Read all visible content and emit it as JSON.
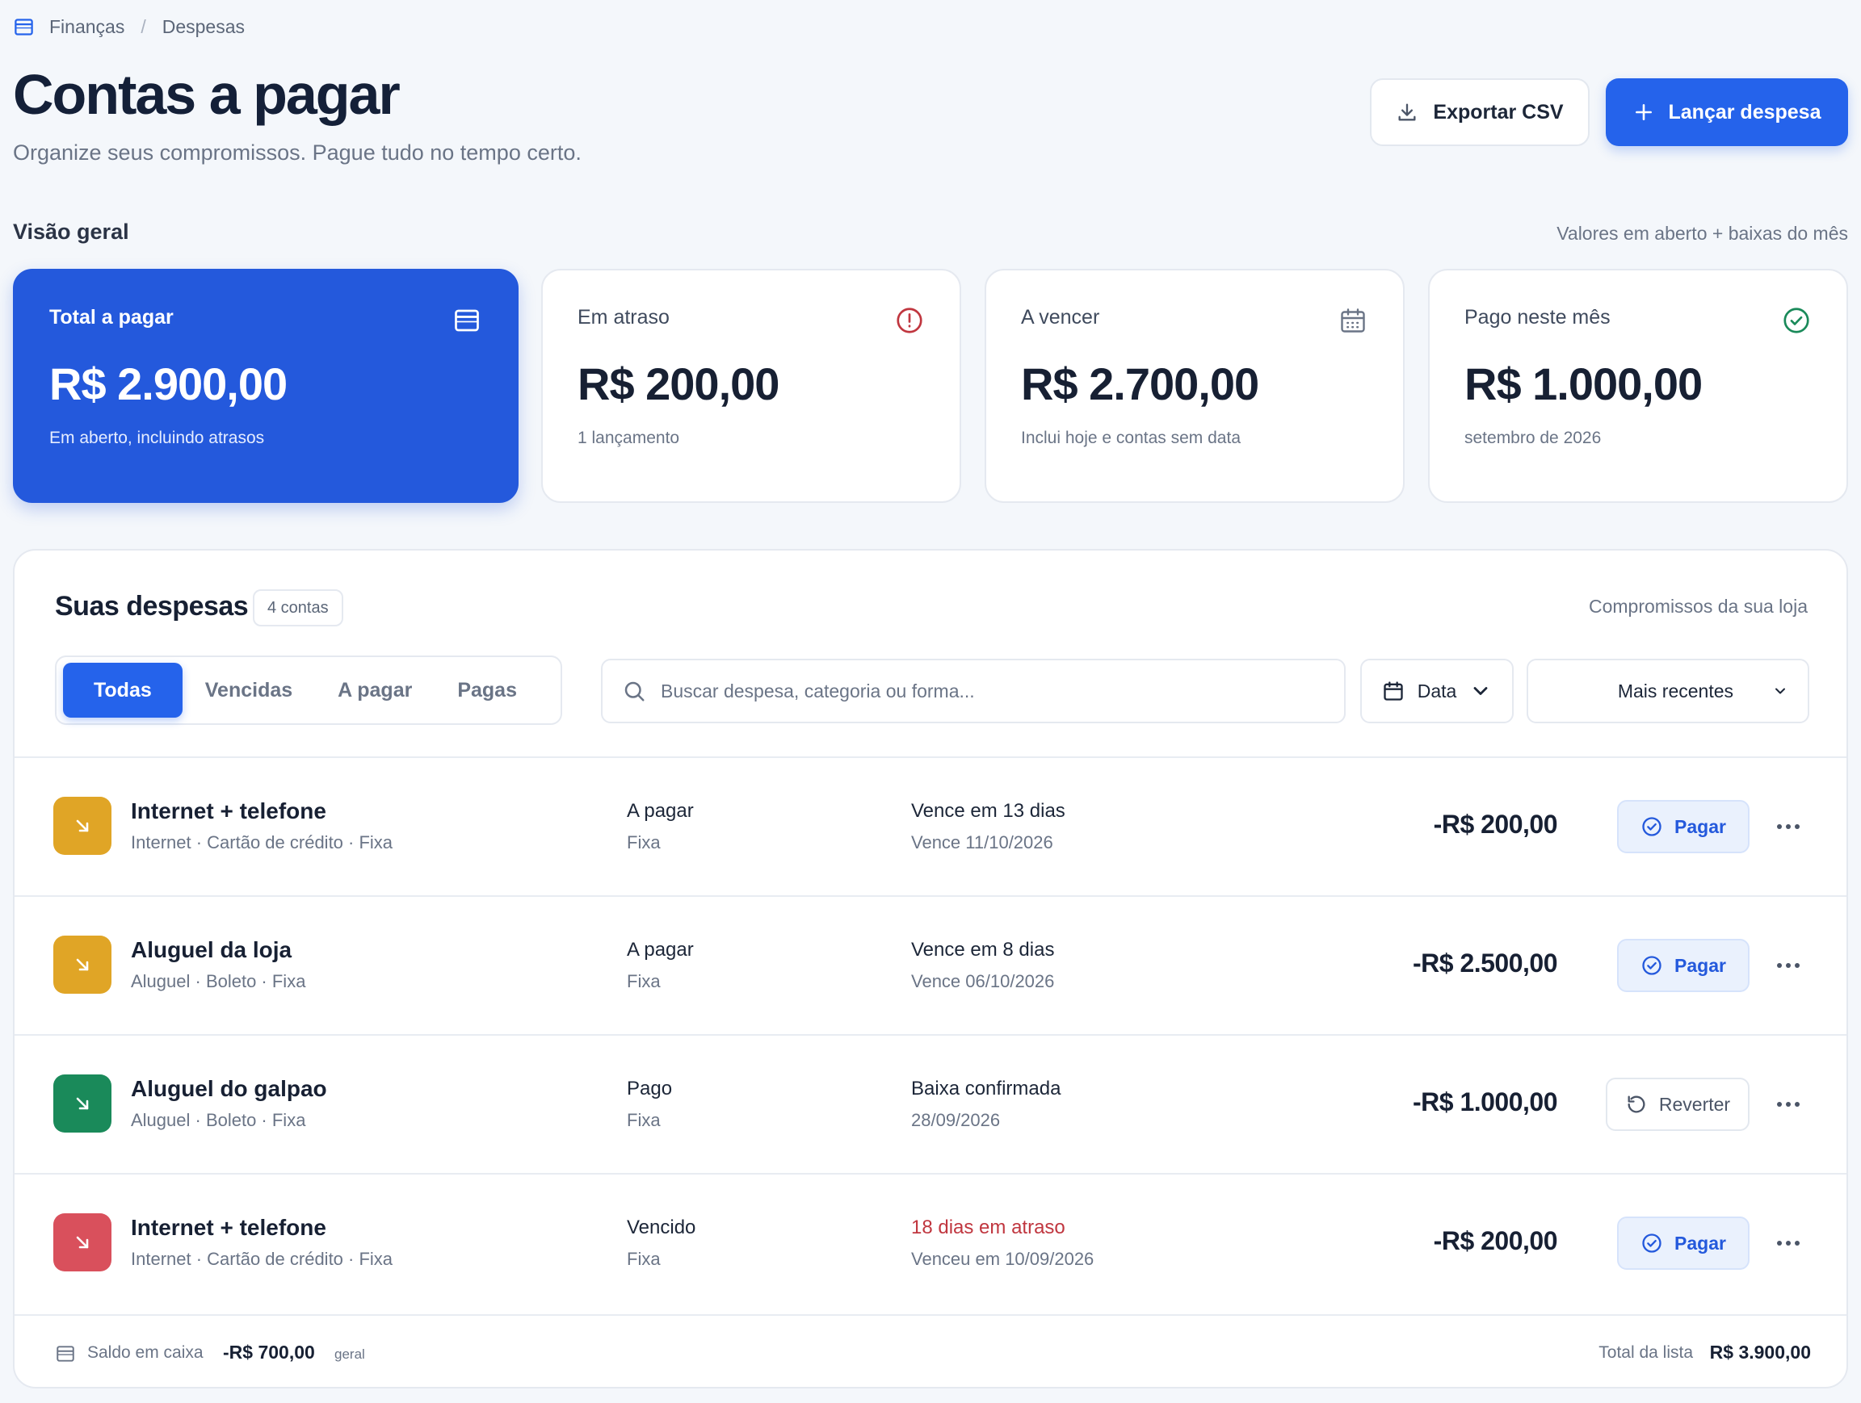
{
  "breadcrumb": {
    "root": "Finanças",
    "separator": "/",
    "current": "Despesas"
  },
  "header": {
    "title": "Contas a pagar",
    "subtitle": "Organize seus compromissos. Pague tudo no tempo certo.",
    "export_label": "Exportar CSV",
    "launch_label": "Lançar despesa"
  },
  "overview": {
    "label": "Visão geral",
    "note": "Valores em aberto + baixas do mês",
    "cards": [
      {
        "label": "Total a pagar",
        "value": "R$ 2.900,00",
        "sub": "Em aberto, incluindo atrasos",
        "icon": "wallet-icon"
      },
      {
        "label": "Em atraso",
        "value": "R$ 200,00",
        "sub": "1 lançamento",
        "icon": "alert-circle-icon"
      },
      {
        "label": "A vencer",
        "value": "R$ 2.700,00",
        "sub": "Inclui hoje e contas sem data",
        "icon": "calendar-icon"
      },
      {
        "label": "Pago neste mês",
        "value": "R$ 1.000,00",
        "sub": "setembro de 2026",
        "icon": "check-circle-icon"
      }
    ]
  },
  "list": {
    "title": "Suas despesas",
    "count": "4 contas",
    "note": "Compromissos da sua loja",
    "tabs": [
      {
        "label": "Todas",
        "active": true
      },
      {
        "label": "Vencidas",
        "active": false
      },
      {
        "label": "A pagar",
        "active": false
      },
      {
        "label": "Pagas",
        "active": false
      }
    ],
    "search_placeholder": "Buscar despesa, categoria ou forma...",
    "date_filter": "Data",
    "sort": "Mais recentes",
    "rows": [
      {
        "name": "Internet + telefone",
        "meta": "Internet · Cartão de crédito · Fixa",
        "status": "A pagar",
        "status_sub": "Fixa",
        "due": "Vence em 13 dias",
        "due_sub": "Vence 11/10/2026",
        "amount": "-R$ 200,00",
        "action": "Pagar",
        "color": "#e0a526"
      },
      {
        "name": "Aluguel da loja",
        "meta": "Aluguel · Boleto · Fixa",
        "status": "A pagar",
        "status_sub": "Fixa",
        "due": "Vence em 8 dias",
        "due_sub": "Vence 06/10/2026",
        "amount": "-R$ 2.500,00",
        "action": "Pagar",
        "color": "#e0a526"
      },
      {
        "name": "Aluguel do galpao",
        "meta": "Aluguel · Boleto · Fixa",
        "status": "Pago",
        "status_sub": "Fixa",
        "due": "Baixa confirmada",
        "due_sub": "28/09/2026",
        "amount": "-R$ 1.000,00",
        "action": "Reverter",
        "color": "#1a8a5a"
      },
      {
        "name": "Internet + telefone",
        "meta": "Internet · Cartão de crédito · Fixa",
        "status": "Vencido",
        "status_sub": "Fixa",
        "due": "18 dias em atraso",
        "due_sub": "Venceu em 10/09/2026",
        "amount": "-R$ 200,00",
        "action": "Pagar",
        "color": "#d9505c"
      }
    ]
  },
  "footer": {
    "balance_label": "Saldo em caixa",
    "balance_value": "-R$ 700,00",
    "balance_tag": "geral",
    "total_label": "Total da lista",
    "total_value": "R$ 3.900,00"
  }
}
